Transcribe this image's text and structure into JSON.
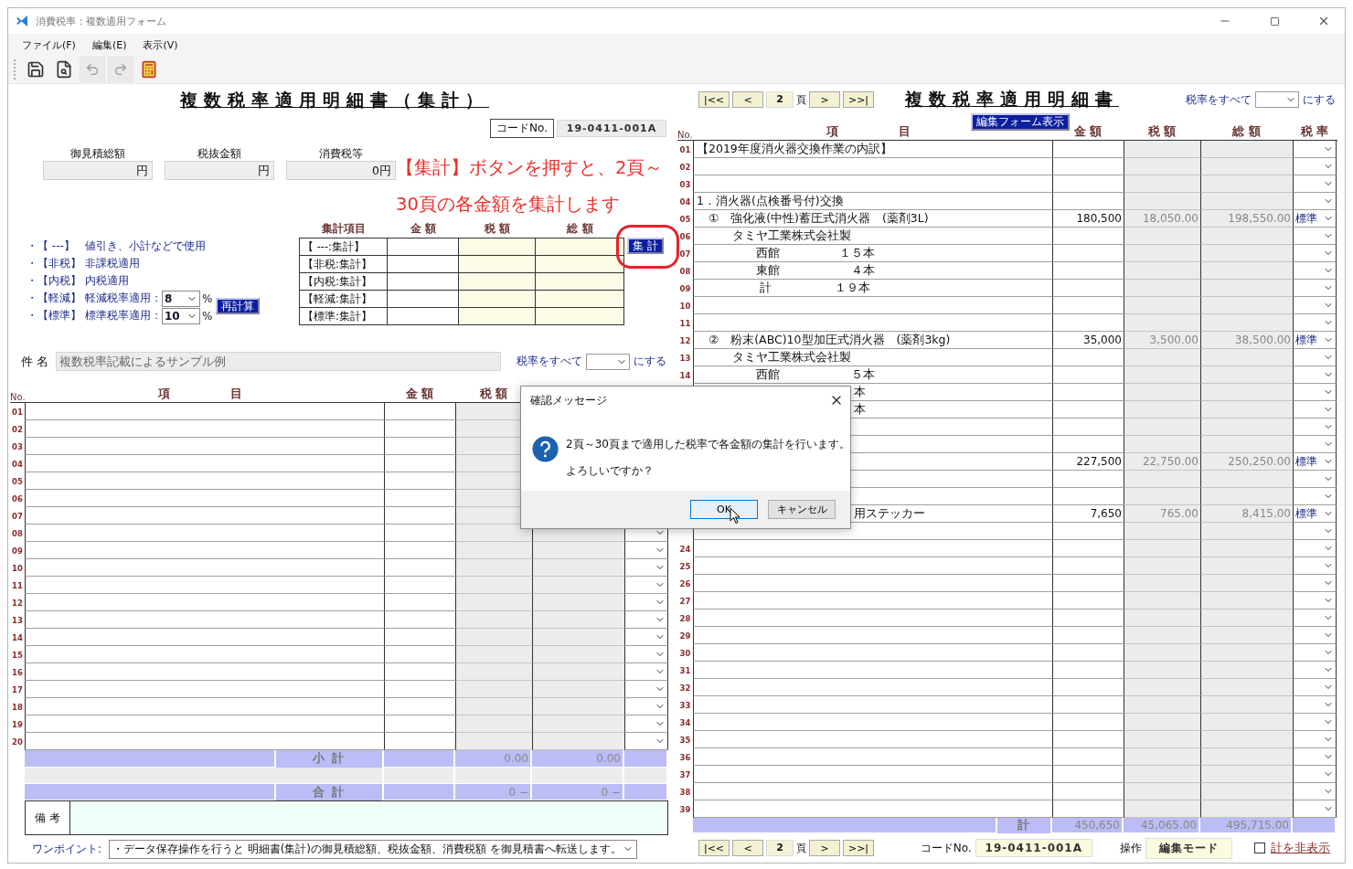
{
  "window": {
    "title": "消費税率：複数適用フォーム"
  },
  "menu": [
    "ファイル(F)",
    "編集(E)",
    "表示(V)"
  ],
  "toolbar": [
    {
      "kind": "save",
      "disabled": false
    },
    {
      "kind": "preview",
      "disabled": false
    },
    {
      "kind": "undo",
      "disabled": true
    },
    {
      "kind": "redo",
      "disabled": true
    },
    {
      "kind": "calculator",
      "disabled": false
    }
  ],
  "summary": {
    "title": "複数税率適用明細書（集計）",
    "code_label": "コードNo.",
    "code": "19-0411-001A",
    "totals": [
      {
        "label": "御見積総額",
        "value": "円"
      },
      {
        "label": "税抜金額",
        "value": "円"
      },
      {
        "label": "消費税等",
        "value": "0円"
      }
    ]
  },
  "annotation": [
    "【集計】ボタンを押すと、2頁～",
    "30頁の各金額を集計します"
  ],
  "legend": [
    {
      "tag": "・【 ---】",
      "text": "値引き、小計などで使用"
    },
    {
      "tag": "・【非税】",
      "text": "非課税適用"
    },
    {
      "tag": "・【内税】",
      "text": "内税適用"
    },
    {
      "tag": "・【軽減】",
      "text": "軽減税率適用：",
      "rate": "8",
      "unit": "%"
    },
    {
      "tag": "・【標準】",
      "text": "標準税率適用：",
      "rate": "10",
      "unit": "%"
    }
  ],
  "recalc_button": "再計算",
  "aggregate": {
    "columns": [
      "集計項目",
      "金 額",
      "税 額",
      "総 額"
    ],
    "rows": [
      "【 ---:集計】",
      "【非税:集計】",
      "【内税:集計】",
      "【軽減:集計】",
      "【標準:集計】"
    ],
    "button": "集 計"
  },
  "subject": {
    "label": "件 名",
    "value": "複数税率記載によるサンプル例",
    "rate_all_label": "税率をすべて",
    "rate_all_suffix": "にする"
  },
  "detail": {
    "columns": [
      "No.",
      "項",
      "目",
      "金 額",
      "税 額"
    ],
    "rows": [
      {
        "no": "01",
        "kind": "covered"
      },
      {
        "no": "02",
        "kind": "covered"
      },
      {
        "no": "03",
        "kind": "covered"
      },
      {
        "no": "04",
        "kind": "covered"
      },
      {
        "no": "05",
        "kind": "covered"
      },
      {
        "no": "06",
        "kind": "covered"
      },
      {
        "no": "07",
        "kind": "covered"
      },
      {
        "no": "08",
        "kind": "line"
      },
      {
        "no": "09",
        "kind": "line"
      },
      {
        "no": "10",
        "kind": "line"
      },
      {
        "no": "11",
        "kind": "line"
      },
      {
        "no": "12",
        "kind": "line"
      },
      {
        "no": "13",
        "kind": "line"
      },
      {
        "no": "14",
        "kind": "line"
      },
      {
        "no": "15",
        "kind": "line"
      },
      {
        "no": "16",
        "kind": "line"
      },
      {
        "no": "17",
        "kind": "line"
      },
      {
        "no": "18",
        "kind": "line"
      },
      {
        "no": "19",
        "kind": "line"
      },
      {
        "no": "20",
        "kind": "line"
      }
    ],
    "subtotal": {
      "label": "小 計",
      "tax": "0.00",
      "total": "0.00"
    },
    "total": {
      "label": "合 計",
      "tax": "0 −",
      "total": "0 −"
    },
    "remarks_label": "備 考"
  },
  "tip": {
    "label": "ワンポイント:",
    "value": "・データ保存操作を行うと 明細書(集計)の御見積総額、税抜金額、消費税額 を御見積書へ転送します。"
  },
  "top_pager": {
    "first": "|<<",
    "prev": "<",
    "page": "2",
    "unit": "頁",
    "next": ">",
    "last": ">>|"
  },
  "sheet": {
    "title": "複数税率適用明細書",
    "rate_all_label": "税率をすべて",
    "rate_all_suffix": "にする",
    "edit_form_button": "編集フォーム表示",
    "columns": [
      "No.",
      "項",
      "目",
      "金 額",
      "税 額",
      "総 額",
      "税 率"
    ],
    "rows": [
      {
        "no": "01",
        "kind": "line",
        "item": "【2019年度消火器交換作業の内訳】"
      },
      {
        "no": "02",
        "kind": "line"
      },
      {
        "no": "03",
        "kind": "line"
      },
      {
        "no": "04",
        "kind": "line",
        "item": "1．消火器(点検番号付)交換"
      },
      {
        "no": "05",
        "kind": "line",
        "item": "　①　強化液(中性)蓄圧式消火器　(薬剤3L)",
        "amount": "180,500",
        "tax": "18,050.00",
        "total": "198,550.00",
        "rate": "標準"
      },
      {
        "no": "06",
        "kind": "line",
        "item": "　　　タミヤ工業株式会社製"
      },
      {
        "no": "07",
        "kind": "line",
        "item": "　　　　　西館　　　　　１５本"
      },
      {
        "no": "08",
        "kind": "line",
        "item": "　　　　　東館　　　　　　４本"
      },
      {
        "no": "09",
        "kind": "line",
        "item": "　　　　　 計　　　　　 １９本"
      },
      {
        "no": "10",
        "kind": "line"
      },
      {
        "no": "11",
        "kind": "line"
      },
      {
        "no": "12",
        "kind": "line",
        "item": "　②　粉末(ABC)10型加圧式消火器　(薬剤3kg)",
        "amount": "35,000",
        "tax": "3,500.00",
        "total": "38,500.00",
        "rate": "標準"
      },
      {
        "no": "13",
        "kind": "line",
        "item": "　　　タミヤ工業株式会社製"
      },
      {
        "no": "14",
        "kind": "line",
        "item": "　　　　　西館　　　　　　５本"
      },
      {
        "kind": "covered",
        "item": "本"
      },
      {
        "kind": "covered",
        "item": "本"
      },
      {
        "kind": "covered"
      },
      {
        "kind": "covered"
      },
      {
        "kind": "covered",
        "amount": "227,500",
        "tax": "22,750.00",
        "total": "250,250.00",
        "rate": "標準"
      },
      {
        "kind": "covered"
      },
      {
        "kind": "covered"
      },
      {
        "kind": "covered",
        "item": "用ステッカー",
        "amount": "7,650",
        "tax": "765.00",
        "total": "8,415.00",
        "rate": "標準"
      },
      {
        "kind": "covered"
      },
      {
        "no": "24",
        "kind": "line"
      },
      {
        "no": "25",
        "kind": "line"
      },
      {
        "no": "26",
        "kind": "line"
      },
      {
        "no": "27",
        "kind": "line"
      },
      {
        "no": "28",
        "kind": "line"
      },
      {
        "no": "29",
        "kind": "line"
      },
      {
        "no": "30",
        "kind": "line"
      },
      {
        "no": "31",
        "kind": "line"
      },
      {
        "no": "32",
        "kind": "line"
      },
      {
        "no": "33",
        "kind": "line"
      },
      {
        "no": "34",
        "kind": "line"
      },
      {
        "no": "35",
        "kind": "line"
      },
      {
        "no": "36",
        "kind": "line"
      },
      {
        "no": "37",
        "kind": "line"
      },
      {
        "no": "38",
        "kind": "line"
      },
      {
        "no": "39",
        "kind": "line"
      }
    ],
    "sum": {
      "label": "計",
      "amount": "450,650",
      "tax": "45,065.00",
      "total": "495,715.00"
    }
  },
  "footer": {
    "pager": {
      "first": "|<<",
      "prev": "<",
      "page": "2",
      "unit": "頁",
      "next": ">",
      "last": ">>|"
    },
    "code_label": "コードNo.",
    "code": "19-0411-001A",
    "mode_label": "操作",
    "mode": "編集モード",
    "hide_sum": {
      "label": "計を非表示",
      "checked": false
    }
  },
  "dialog": {
    "title": "確認メッセージ",
    "lines": [
      "2頁～30頁まで適用した税率で各金額の集計を行います。",
      "よろしいですか？"
    ],
    "buttons": [
      {
        "label": "OK",
        "selected": true
      },
      {
        "label": "キャンセル",
        "selected": false
      }
    ]
  }
}
